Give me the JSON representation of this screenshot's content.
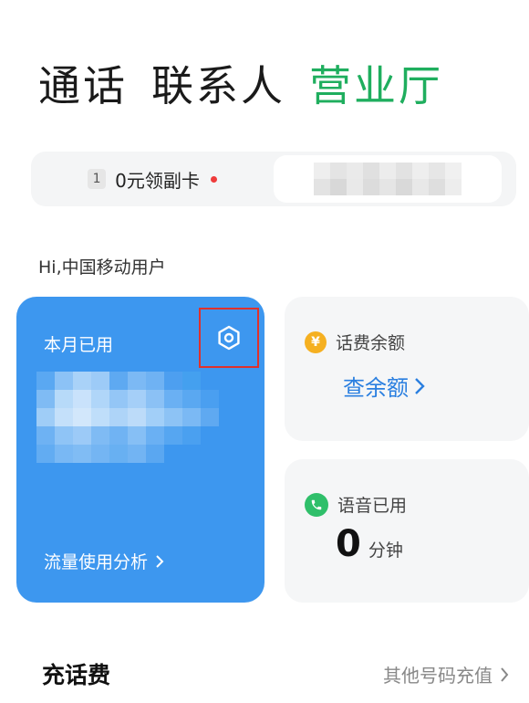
{
  "tabs": [
    {
      "label": "通话",
      "active": false
    },
    {
      "label": "联系人",
      "active": false
    },
    {
      "label": "营业厅",
      "active": true
    }
  ],
  "sim_promo": {
    "badge": "1",
    "label": "0元领副卡"
  },
  "greeting": "Hi,中国移动用户",
  "usage_card": {
    "title": "本月已用",
    "analysis_link": "流量使用分析"
  },
  "balance_card": {
    "title": "话费余额",
    "link": "查余额",
    "icon_symbol": "¥"
  },
  "voice_card": {
    "title": "语音已用",
    "value": "0",
    "unit": "分钟"
  },
  "recharge": {
    "title": "充话费",
    "other_link": "其他号码充值"
  },
  "colors": {
    "accent_green": "#1fae5e",
    "card_blue": "#3d97ef",
    "link_blue": "#2a7fe0"
  }
}
